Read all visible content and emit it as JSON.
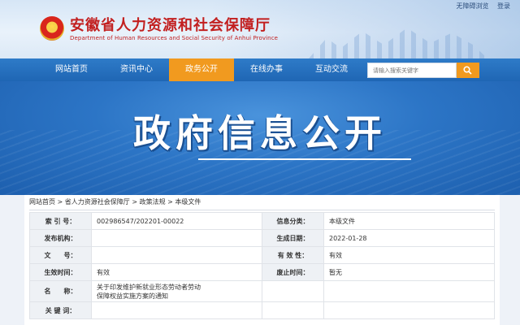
{
  "header": {
    "title": "安徽省人力资源和社会保障厅",
    "subtitle": "Department of Human Resources and Social Security of Anhui Province",
    "links": [
      "无障碍浏览",
      "登录"
    ]
  },
  "nav": {
    "items": [
      "网站首页",
      "资讯中心",
      "政务公开",
      "在线办事",
      "互动交流"
    ],
    "active": "政务公开",
    "search_placeholder": "请输入搜索关键字"
  },
  "banner": {
    "title": "政府信息公开"
  },
  "breadcrumb": [
    "网站首页",
    "省人力资源社会保障厅",
    "政策法规",
    "本级文件"
  ],
  "info": {
    "index_label": "索 引 号：",
    "index_value": "002986547/202201-00022",
    "category_label": "信息分类：",
    "category_value": "本级文件",
    "publisher_label": "发布机构：",
    "publisher_value": "",
    "date_label": "生成日期：",
    "date_value": "2022-01-28",
    "docno_label": "文　　号：",
    "docno_value": "",
    "valid_label": "有 效 性：",
    "valid_value": "有效",
    "effective_label": "生效时间：",
    "effective_value": "有效",
    "repeal_label": "废止时间：",
    "repeal_value": "暂无",
    "name_label": "名　　称：",
    "name_value_line1": "关于印发维护新就业形态劳动者劳动",
    "name_value_line2": "保障权益实施方案的通知",
    "keywords_label": "关 键 词：",
    "keywords_value": ""
  },
  "colors": {
    "nav_blue": "#1f66b4",
    "active_orange": "#f19a1f",
    "title_red": "#c21f1f"
  }
}
